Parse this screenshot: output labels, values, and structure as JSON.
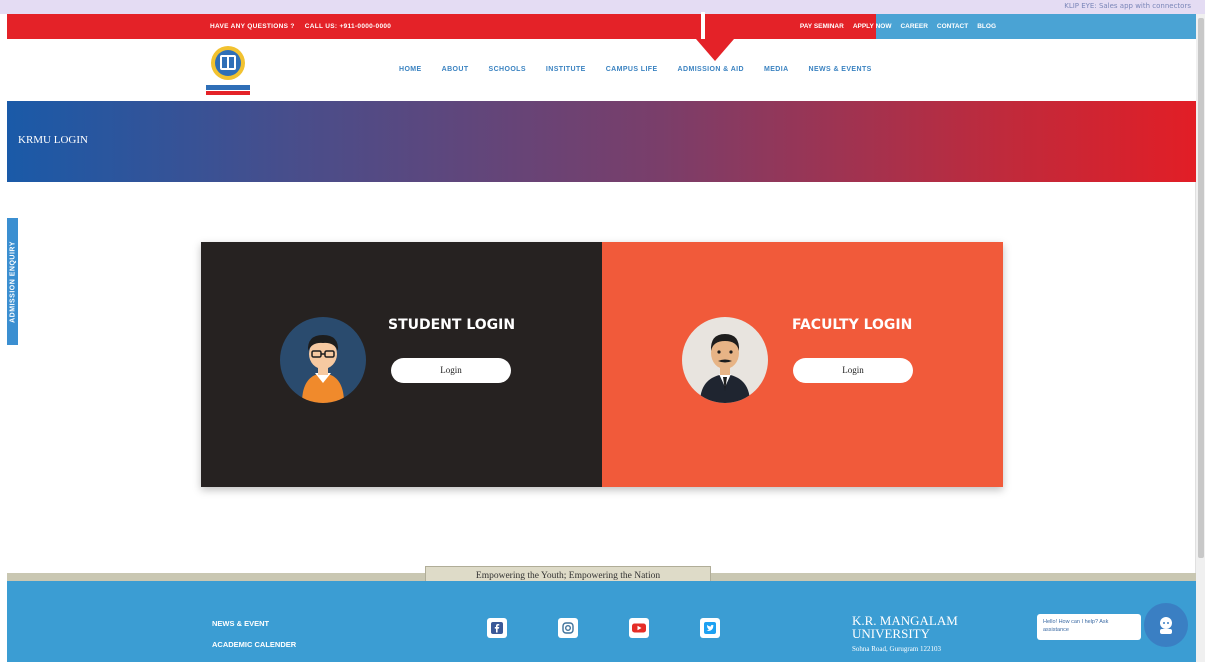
{
  "browser": {
    "note": "KLIP EYE: Sales app with connectors"
  },
  "topbar": {
    "questions": "HAVE ANY QUESTIONS ?",
    "call": "CALL US: +911-0000-0000",
    "links": [
      "PAY SEMINAR",
      "APPLY NOW",
      "CAREER",
      "CONTACT",
      "BLOG"
    ]
  },
  "nav": {
    "items": [
      "HOME",
      "ABOUT",
      "SCHOOLS",
      "INSTITUTE",
      "CAMPUS LIFE",
      "ADMISSION & AID",
      "MEDIA",
      "NEWS & EVENTS"
    ]
  },
  "banner": {
    "title": "KRMU LOGIN"
  },
  "side_tab": {
    "label": "ADMISSION ENQUIRY"
  },
  "student": {
    "title": "STUDENT LOGIN",
    "button": "Login"
  },
  "faculty": {
    "title": "FACULTY LOGIN",
    "button": "Login"
  },
  "tagline": "Empowering the Youth; Empowering the Nation",
  "footer": {
    "links": [
      "NEWS & EVENT",
      "ACADEMIC CALENDER"
    ],
    "university_line1": "K.R. MANGALAM",
    "university_line2": "UNIVERSITY",
    "address": "Sohna Road, Gurugram 122103",
    "chat_text": "Hello! How can I help? Ask assistance"
  },
  "colors": {
    "red": "#e42228",
    "blue": "#4aa3d4",
    "dark_panel": "#262221",
    "orange_panel": "#f15a3a",
    "footer_blue": "#3b9dd3"
  },
  "icons": [
    "logo",
    "facebook-icon",
    "instagram-icon",
    "youtube-icon",
    "twitter-icon",
    "chat-icon"
  ]
}
